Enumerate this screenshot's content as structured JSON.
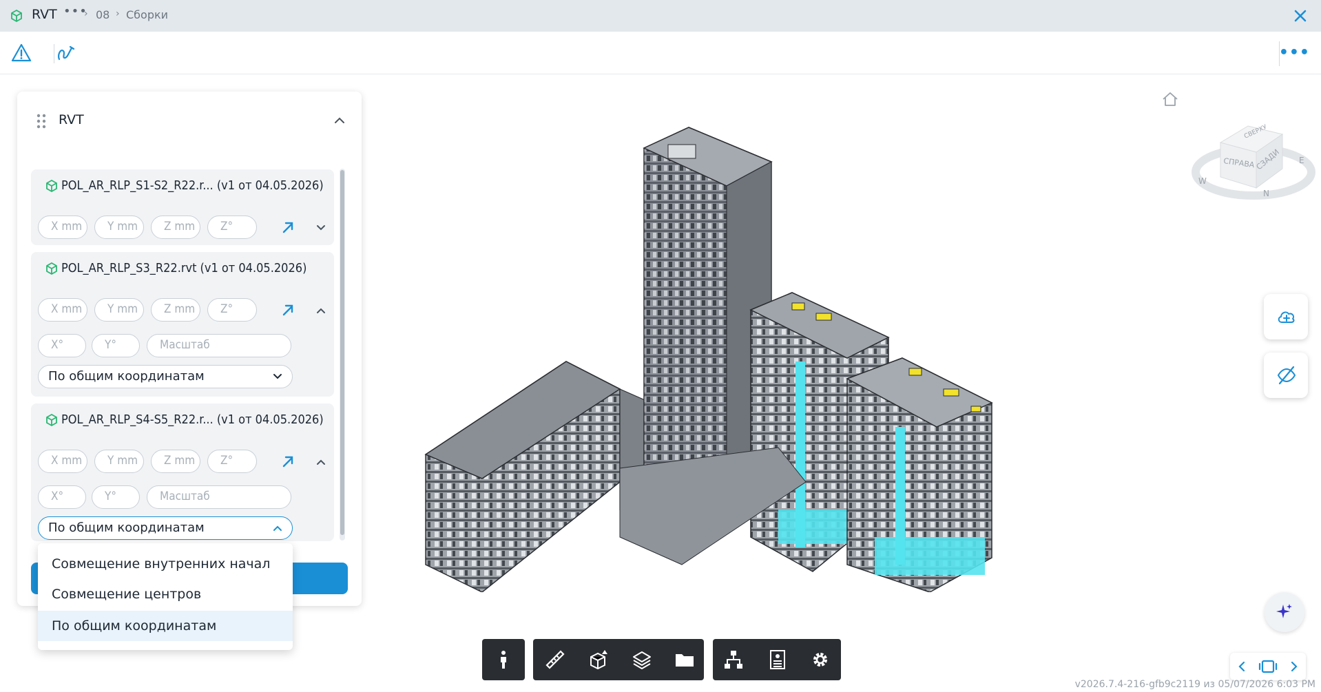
{
  "titlebar": {
    "title": "RVT",
    "more": "•••",
    "crumbs": [
      "08",
      "Сборки"
    ],
    "separator": "›"
  },
  "toolbar": {
    "more": "•••"
  },
  "panel": {
    "title": "RVT",
    "cards": [
      {
        "title": "POL_AR_RLP_S1-S2_R22.r... (v1 от 04.05.2026)",
        "fields": [
          "X mm",
          "Y mm",
          "Z mm",
          "Z°"
        ],
        "expanded": false
      },
      {
        "title": "POL_AR_RLP_S3_R22.rvt (v1 от 04.05.2026)",
        "fields": [
          "X mm",
          "Y mm",
          "Z mm",
          "Z°"
        ],
        "fields2": [
          "X°",
          "Y°",
          "Масштаб"
        ],
        "select_value": "По общим координатам",
        "expanded": true
      },
      {
        "title": "POL_AR_RLP_S4-S5_R22.r... (v1 от 04.05.2026)",
        "fields": [
          "X mm",
          "Y mm",
          "Z mm",
          "Z°"
        ],
        "fields2": [
          "X°",
          "Y°",
          "Масштаб"
        ],
        "select_value": "По общим координатам",
        "expanded": true
      }
    ]
  },
  "dropdown": {
    "options": [
      "Совмещение внутренних начал",
      "Совмещение центров",
      "По общим координатам"
    ],
    "selected_index": 2
  },
  "viewcube": {
    "faces": [
      "СПРАВА",
      "СЗАДИ",
      "СВЕРХУ"
    ],
    "compass": [
      "E",
      "N",
      "W"
    ]
  },
  "colors": {
    "accent": "#1a8fd6",
    "toolbar_dark": "#2a2d31",
    "model_green": "#2bb673"
  },
  "version": "v2026.7.4-216-gfb9c2119 из 05/07/2026 6:03 PM"
}
